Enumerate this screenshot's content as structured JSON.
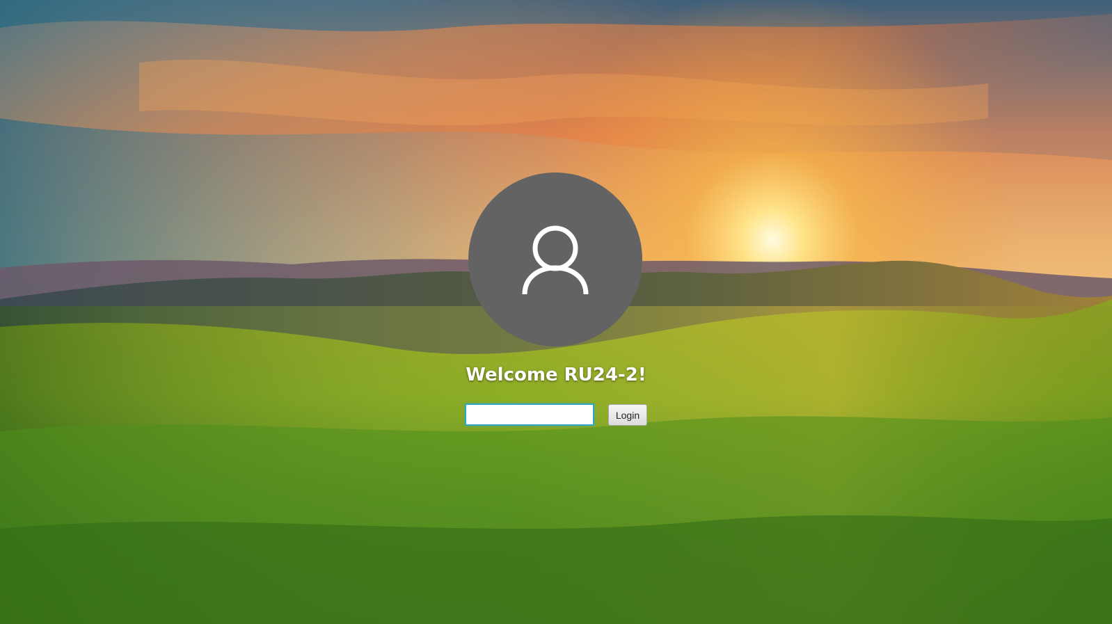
{
  "login": {
    "welcome_text": "Welcome RU24-2!",
    "password_value": "",
    "login_button_label": "Login"
  },
  "icons": {
    "avatar": "user-icon"
  },
  "colors": {
    "avatar_background": "#636363",
    "input_focus_border": "#2ea7c6",
    "welcome_text": "#ffffff"
  }
}
